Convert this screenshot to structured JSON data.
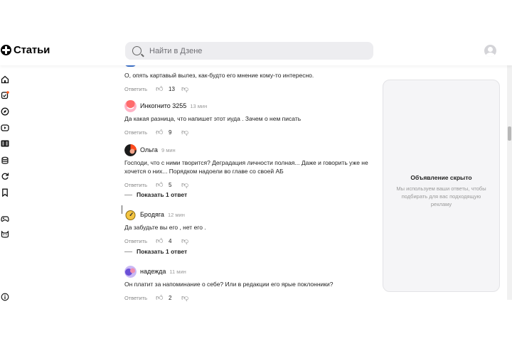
{
  "header": {
    "logo_text": "Статьи",
    "search_placeholder": "Найти в Дзене"
  },
  "sidebar": {
    "icons": [
      "home-icon",
      "notifications-icon",
      "compass-icon",
      "video-icon",
      "articles-icon",
      "database-icon",
      "refresh-icon",
      "bookmark-icon",
      "games-icon",
      "cat-icon",
      "info-icon"
    ]
  },
  "comments": [
    {
      "name": "",
      "time": "",
      "text": "О, опять картавый вылез, как-будто его мнение кому-то интересно.",
      "reply": "Ответить",
      "likes": "13"
    },
    {
      "name": "Инкогнито 3255",
      "time": "13 мин",
      "text": "Да какая разница, что напишет этот иуда . Зачем о нем писать",
      "reply": "Ответить",
      "likes": "9"
    },
    {
      "name": "Ольга",
      "time": "9 мин",
      "text": "Господи, что с ними творится? Деградация личности полная... Даже и говорить уже не хочется о них... Порядком надоели во главе со своей АБ",
      "reply": "Ответить",
      "likes": "5",
      "show_replies": "Показать 1 ответ"
    },
    {
      "name": "Бродяга",
      "time": "12 мин",
      "text": "Да забудьте вы его , нет его .",
      "reply": "Ответить",
      "likes": "4",
      "show_replies": "Показать 1 ответ"
    },
    {
      "name": "надежда",
      "time": "11 мин",
      "text": "Он платит за напоминание о себе? Или в редакции его ярые поклонники?",
      "reply": "Ответить",
      "likes": "2"
    }
  ],
  "ad": {
    "title": "Объявление скрыто",
    "subtitle": "Мы используем ваши ответы, чтобы подбирать для вас подходящую рекламу"
  },
  "colors": {
    "search_bg": "#ededf0",
    "ad_bg": "#f5f5f7",
    "notification_dot": "#ff5a1f"
  }
}
